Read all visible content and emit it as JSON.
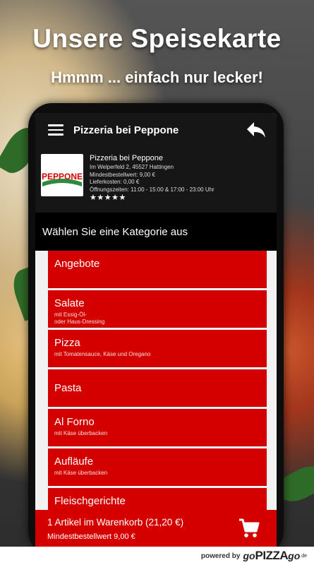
{
  "promo": {
    "headline": "Unsere Speisekarte",
    "subline": "Hmmm ... einfach nur lecker!"
  },
  "appbar": {
    "title": "Pizzeria bei Peppone"
  },
  "restaurant": {
    "name": "Pizzeria bei Peppone",
    "logo_text": "PEPPONE",
    "address": "Im Welperfeld 2, 45527 Hattingen",
    "min_order": "Mindestbestellwert: 9,00 €",
    "delivery_cost": "Lieferkosten: 0,00 €",
    "hours": "Öffnungszeiten: 11:00 - 15:00 & 17:00 - 23:00 Uhr",
    "rating_stars": "★★★★★",
    "rating": 5
  },
  "category_header": "Wählen Sie eine Kategorie aus",
  "categories": [
    {
      "title": "Angebote",
      "subtitle": ""
    },
    {
      "title": "Salate",
      "subtitle": "mit Essig-Öl-\n oder Haus-Dressing"
    },
    {
      "title": "Pizza",
      "subtitle": "mit Tomatensauce, Käse und Oregano"
    },
    {
      "title": "Pasta",
      "subtitle": ""
    },
    {
      "title": "Al Forno",
      "subtitle": "mit Käse überbacken"
    },
    {
      "title": "Aufläufe",
      "subtitle": "mit Käse überbacken"
    },
    {
      "title": "Fleischgerichte",
      "subtitle": ""
    }
  ],
  "cart": {
    "summary": "1 Artikel im Warenkorb (21,20 €)",
    "min_order": "Mindestbestellwert 9,00 €"
  },
  "footer": {
    "powered_by": "powered by",
    "brand_pre": "go",
    "brand_main": "PIZZA",
    "brand_post": "go",
    "brand_tld": ".de"
  },
  "colors": {
    "accent_red": "#d40000",
    "appbar_bg": "#161616",
    "category_header_bg": "#000000"
  },
  "icons": {
    "menu": "hamburger-menu-icon",
    "back": "reply-arrow-icon",
    "cart": "shopping-cart-icon"
  }
}
